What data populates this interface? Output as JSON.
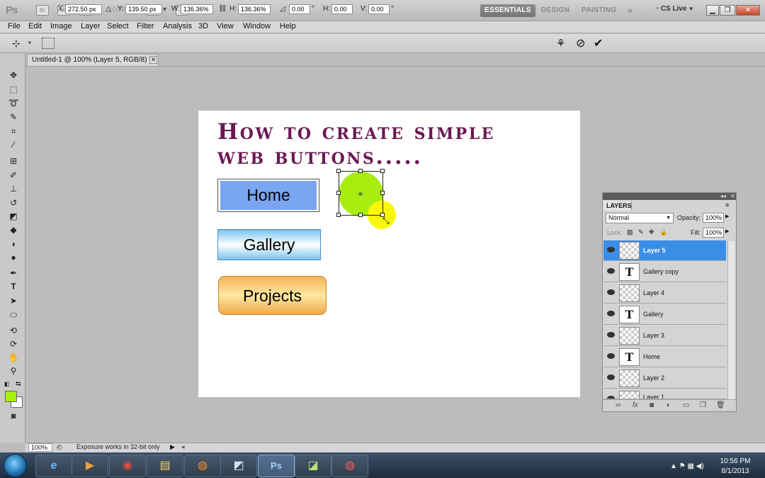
{
  "app": {
    "logo": "Ps",
    "zoom_display": "100%",
    "workspaces": [
      "ESSENTIALS",
      "DESIGN",
      "PAINTING"
    ],
    "more_glyph": "»",
    "cs_live": "CS Live"
  },
  "menu": [
    "File",
    "Edit",
    "Image",
    "Layer",
    "Select",
    "Filter",
    "Analysis",
    "3D",
    "View",
    "Window",
    "Help"
  ],
  "options": {
    "x_label": "X:",
    "x_value": "272.50 px",
    "y_label": "Y:",
    "y_value": "139.50 px",
    "w_label": "W:",
    "w_value": "136.36%",
    "h_label": "H:",
    "h_value": "136.36%",
    "angle_value": "0.00",
    "angle_unit": "°",
    "hskew_label": "H:",
    "hskew_value": "0.00",
    "vskew_label": "V:",
    "vskew_value": "0.00",
    "skew_unit": "°"
  },
  "document": {
    "tab_title": "Untitled-1 @ 100% (Layer 5, RGB/8) *",
    "heading_line1": "How to create simple",
    "heading_line2": "web buttons.....",
    "button_home": "Home",
    "button_gallery": "Gallery",
    "button_projects": "Projects"
  },
  "layers_panel": {
    "tab": "LAYERS",
    "blend_mode": "Normal",
    "opacity_label": "Opacity:",
    "opacity_value": "100%",
    "lock_label": "Lock:",
    "fill_label": "Fill:",
    "fill_value": "100%",
    "layers": [
      {
        "name": "Layer 5",
        "type": "raster",
        "selected": true
      },
      {
        "name": "Gallery copy",
        "type": "text",
        "selected": false
      },
      {
        "name": "Layer 4",
        "type": "raster",
        "selected": false
      },
      {
        "name": "Gallery",
        "type": "text",
        "selected": false
      },
      {
        "name": "Layer 3",
        "type": "raster",
        "selected": false
      },
      {
        "name": "Home",
        "type": "text",
        "selected": false
      },
      {
        "name": "Layer 2",
        "type": "raster",
        "selected": false
      },
      {
        "name": "Layer 1",
        "type": "raster",
        "selected": false
      }
    ],
    "footer_icons": [
      "link-icon",
      "fx-icon",
      "mask-icon",
      "adjustment-icon",
      "group-icon",
      "new-layer-icon",
      "trash-icon"
    ]
  },
  "status": {
    "zoom": "100%",
    "message": "Exposure works in 32-bit only"
  },
  "taskbar": {
    "apps": [
      "ie-icon",
      "media-player-icon",
      "chrome-icon",
      "explorer-icon",
      "firefox-icon",
      "app-icon",
      "photoshop-icon",
      "app2-icon",
      "app3-icon"
    ],
    "photoshop_label": "Ps",
    "time": "10:56 PM",
    "date": "8/1/2013"
  },
  "colors": {
    "foreground": "#a6ee0b",
    "background": "#ffffff",
    "heading": "#6b1854",
    "selected_layer": "#3b8ee8"
  }
}
